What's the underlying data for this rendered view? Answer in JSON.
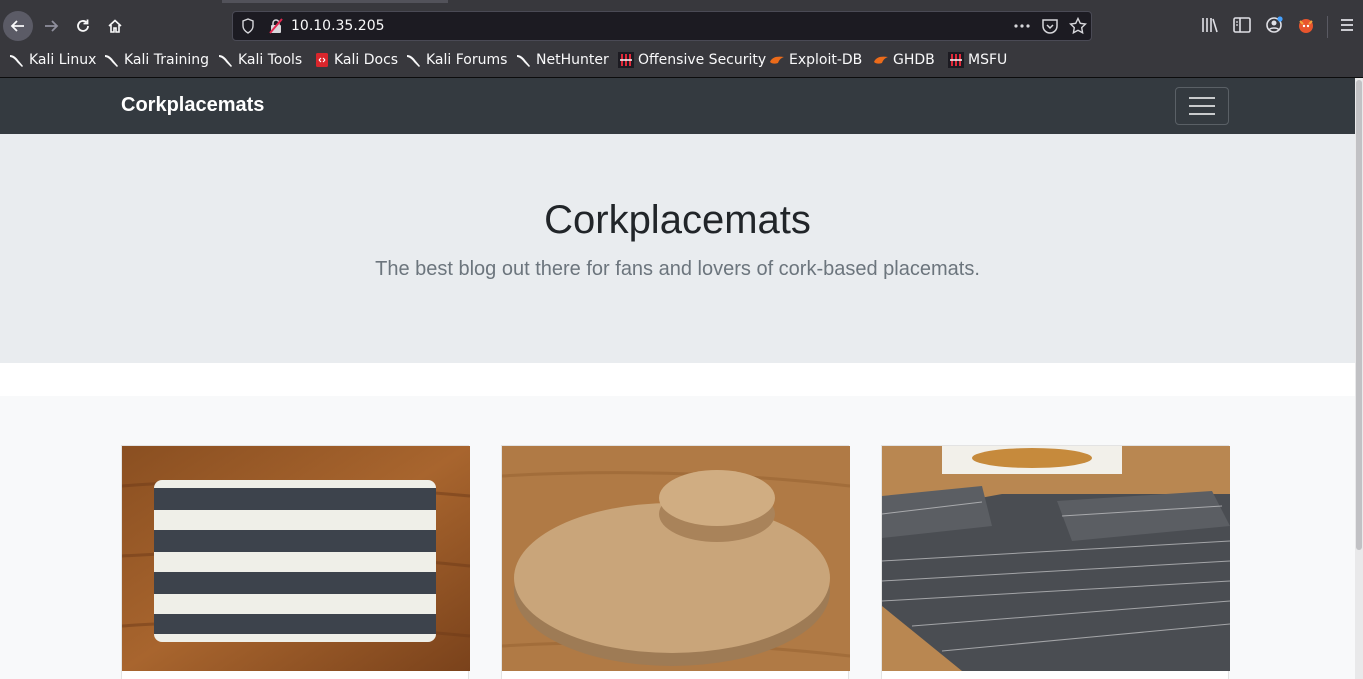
{
  "browser": {
    "url": "10.10.35.205",
    "bookmarks": [
      {
        "label": "Kali Linux",
        "icon": "kali-dragon-icon"
      },
      {
        "label": "Kali Training",
        "icon": "kali-dragon-icon"
      },
      {
        "label": "Kali Tools",
        "icon": "kali-dragon-icon"
      },
      {
        "label": "Kali Docs",
        "icon": "kali-docs-icon"
      },
      {
        "label": "Kali Forums",
        "icon": "kali-dragon-icon"
      },
      {
        "label": "NetHunter",
        "icon": "kali-dragon-icon"
      },
      {
        "label": "Offensive Security",
        "icon": "offsec-icon"
      },
      {
        "label": "Exploit-DB",
        "icon": "exploitdb-icon"
      },
      {
        "label": "GHDB",
        "icon": "exploitdb-icon"
      },
      {
        "label": "MSFU",
        "icon": "offsec-icon"
      }
    ]
  },
  "site": {
    "brand": "Corkplacemats",
    "hero_title": "Corkplacemats",
    "hero_lead": "The best blog out there for fans and lovers of cork-based placemats."
  },
  "cards": [
    {
      "image": "striped-placemat-photo"
    },
    {
      "image": "round-cork-mats-photo"
    },
    {
      "image": "patterned-grey-placemat-photo"
    }
  ]
}
